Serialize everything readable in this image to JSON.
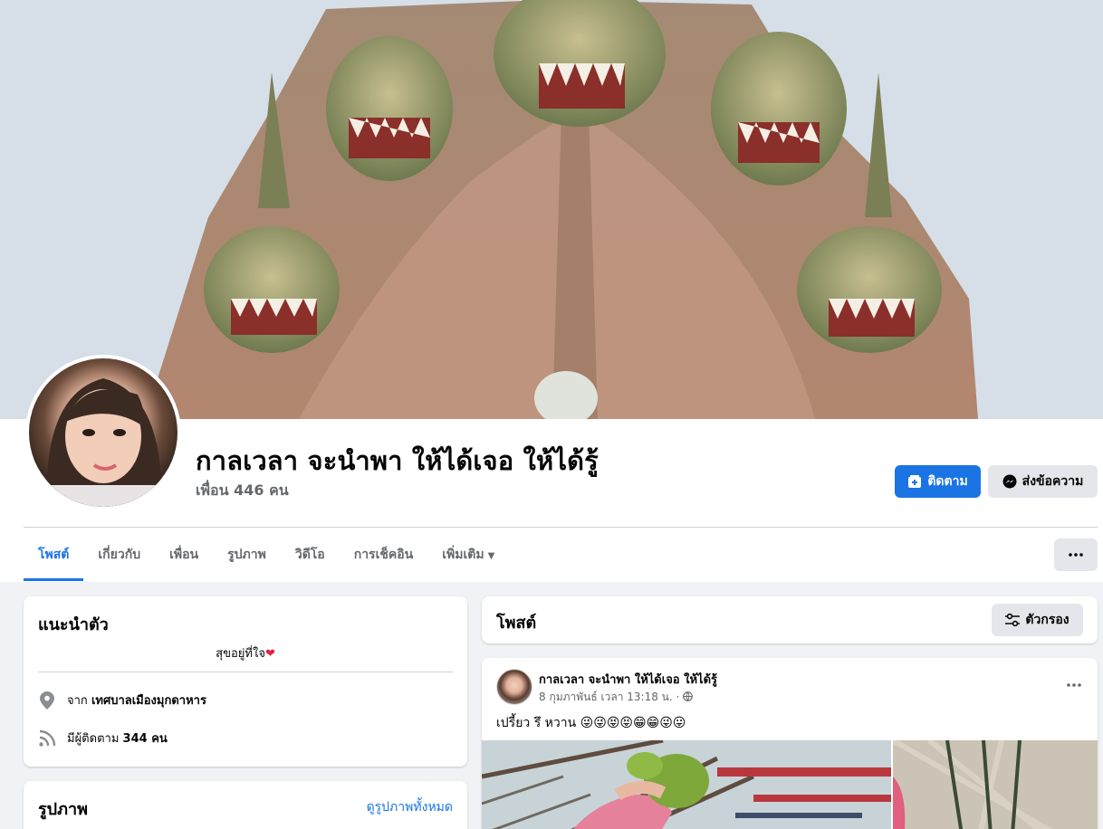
{
  "profile": {
    "name": "กาลเวลา จะนำพา ให้ได้เจอ ให้ได้รู้",
    "friends": "เพื่อน 446 คน"
  },
  "actions": {
    "follow_label": "ติดตาม",
    "message_label": "ส่งข้อความ",
    "more_icon": "ellipsis-icon"
  },
  "tabs": [
    {
      "label": "โพสต์",
      "active": true
    },
    {
      "label": "เกี่ยวกับ"
    },
    {
      "label": "เพื่อน"
    },
    {
      "label": "รูปภาพ"
    },
    {
      "label": "วิดีโอ"
    },
    {
      "label": "การเช็คอิน"
    },
    {
      "label": "เพิ่มเติม"
    }
  ],
  "intro": {
    "title": "แนะนำตัว",
    "bio": "สุขอยู่ที่ใจ",
    "from_prefix": "จาก",
    "from_place": "เทศบาลเมืองมุกดาหาร",
    "followers_prefix": "มีผู้ติดตาม",
    "followers_value": "344 คน"
  },
  "photos": {
    "title": "รูปภาพ",
    "see_all": "ดูรูปภาพทั้งหมด"
  },
  "posts": {
    "title": "โพสต์",
    "filter_label": "ตัวกรอง"
  },
  "post": {
    "author": "กาลเวลา จะนำพา ให้ได้เจอ ให้ได้รู้",
    "time": "8 กุมภาพันธ์ เวลา 13:18 น. ·",
    "text": "เปรี้ยว รึ หวาน 😜😜😝😝😁😁😜😛"
  },
  "colors": {
    "accent": "#1b74e4",
    "background": "#f0f2f5",
    "secondary_button": "#e4e6eb",
    "muted_text": "#65676b"
  }
}
